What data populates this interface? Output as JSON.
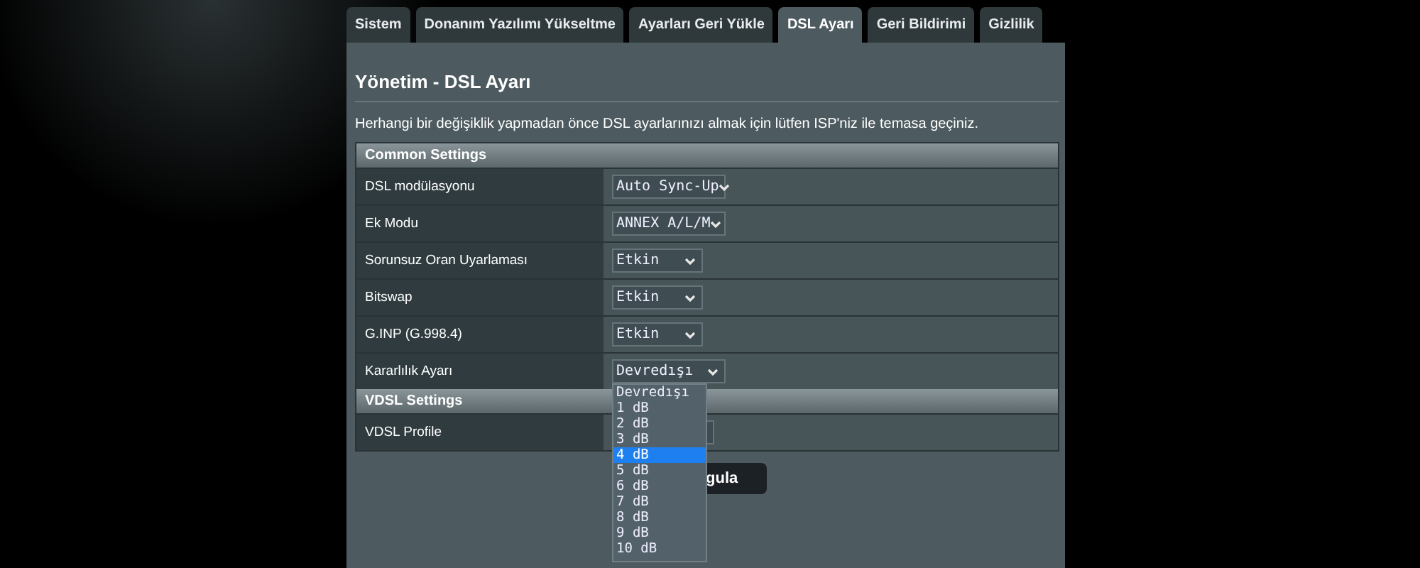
{
  "tabs": [
    {
      "label": "Sistem",
      "selected": false
    },
    {
      "label": "Donanım Yazılımı Yükseltme",
      "selected": false
    },
    {
      "label": "Ayarları Geri Yükle",
      "selected": false
    },
    {
      "label": "DSL Ayarı",
      "selected": true
    },
    {
      "label": "Geri Bildirimi",
      "selected": false
    },
    {
      "label": "Gizlilik",
      "selected": false
    }
  ],
  "title": "Yönetim - DSL Ayarı",
  "notice": "Herhangi bir değişiklik yapmadan önce DSL ayarlarınızı almak için lütfen ISP'niz ile temasa geçiniz.",
  "sections": [
    {
      "title": "Common Settings",
      "rows": [
        {
          "label": "DSL modülasyonu",
          "value": "Auto Sync-Up"
        },
        {
          "label": "Ek Modu",
          "value": "ANNEX A/L/M"
        },
        {
          "label": "Sorunsuz Oran Uyarlaması",
          "value": "Etkin"
        },
        {
          "label": "Bitswap",
          "value": "Etkin"
        },
        {
          "label": "G.INP (G.998.4)",
          "value": "Etkin"
        },
        {
          "label": "Kararlılık Ayarı",
          "value": "Devredışı",
          "options": [
            {
              "label": "Devredışı",
              "highlighted": false
            },
            {
              "label": "1 dB",
              "highlighted": false
            },
            {
              "label": "2 dB",
              "highlighted": false
            },
            {
              "label": "3 dB",
              "highlighted": false
            },
            {
              "label": "4 dB",
              "highlighted": true
            },
            {
              "label": "5 dB",
              "highlighted": false
            },
            {
              "label": "6 dB",
              "highlighted": false
            },
            {
              "label": "7 dB",
              "highlighted": false
            },
            {
              "label": "8 dB",
              "highlighted": false
            },
            {
              "label": "9 dB",
              "highlighted": false
            },
            {
              "label": "10 dB",
              "highlighted": false
            }
          ]
        }
      ]
    },
    {
      "title": "VDSL Settings",
      "rows": [
        {
          "label": "VDSL Profile"
        }
      ]
    }
  ],
  "apply_button": {
    "label": "gula"
  }
}
